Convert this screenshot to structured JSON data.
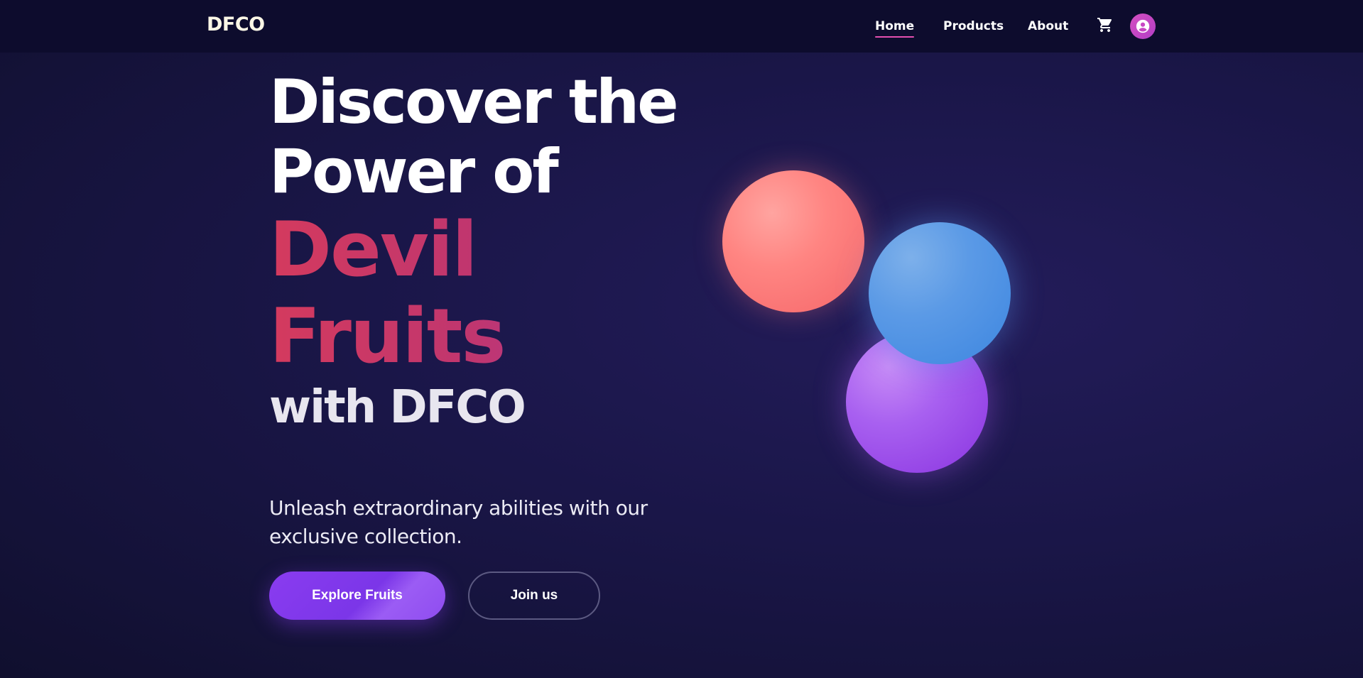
{
  "brand": {
    "logo": "DFCO"
  },
  "nav": {
    "items": [
      {
        "label": "Home",
        "active": true
      },
      {
        "label": "Products",
        "active": false
      },
      {
        "label": "About",
        "active": false
      }
    ],
    "icons": {
      "cart": "cart-icon",
      "user": "user-avatar-icon"
    }
  },
  "hero": {
    "headline_line1": "Discover the",
    "headline_line2": "Power of",
    "highlight_line1": "Devil",
    "highlight_line2": "Fruits",
    "headline_suffix": "with DFCO",
    "tagline": "Unleash extraordinary abilities with our exclusive collection.",
    "primary_button": "Explore Fruits",
    "secondary_button": "Join us"
  },
  "colors": {
    "background": "#1a1648",
    "navbar": "#0d0c2d",
    "accent_pink": "#e44fb0",
    "button_purple": "#8a3cf0",
    "highlight_gradient_start": "#d43a5e",
    "highlight_gradient_end": "#a33cb0",
    "orb_red": "#ff8582",
    "orb_blue": "#5b9ae6",
    "orb_purple": "#a860f0"
  }
}
